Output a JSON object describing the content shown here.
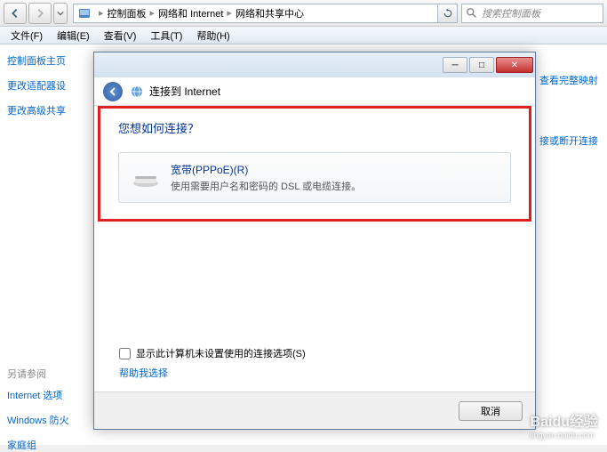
{
  "nav": {
    "breadcrumb": [
      "控制面板",
      "网络和 Internet",
      "网络和共享中心"
    ]
  },
  "search": {
    "placeholder": "搜索控制面板"
  },
  "menu": [
    "文件(F)",
    "编辑(E)",
    "查看(V)",
    "工具(T)",
    "帮助(H)"
  ],
  "sidebar": {
    "links": [
      "控制面板主页",
      "更改适配器设",
      "更改高级共享"
    ],
    "section_title": "另请参阅",
    "section_links": [
      "Internet 选项",
      "Windows 防火",
      "家庭组"
    ]
  },
  "right_links": {
    "link1": "查看完整映射",
    "link2": "接或断开连接"
  },
  "dialog": {
    "title": "连接到 Internet",
    "question": "您想如何连接？",
    "option": {
      "title": "宽带(PPPoE)(R)",
      "desc": "使用需要用户名和密码的 DSL 或电缆连接。"
    },
    "checkbox_label": "显示此计算机未设置使用的连接选项(S)",
    "help_link": "帮助我选择",
    "cancel": "取消"
  },
  "watermark": {
    "main": "Baidu经验",
    "sub": "jingyan.baidu.com"
  }
}
